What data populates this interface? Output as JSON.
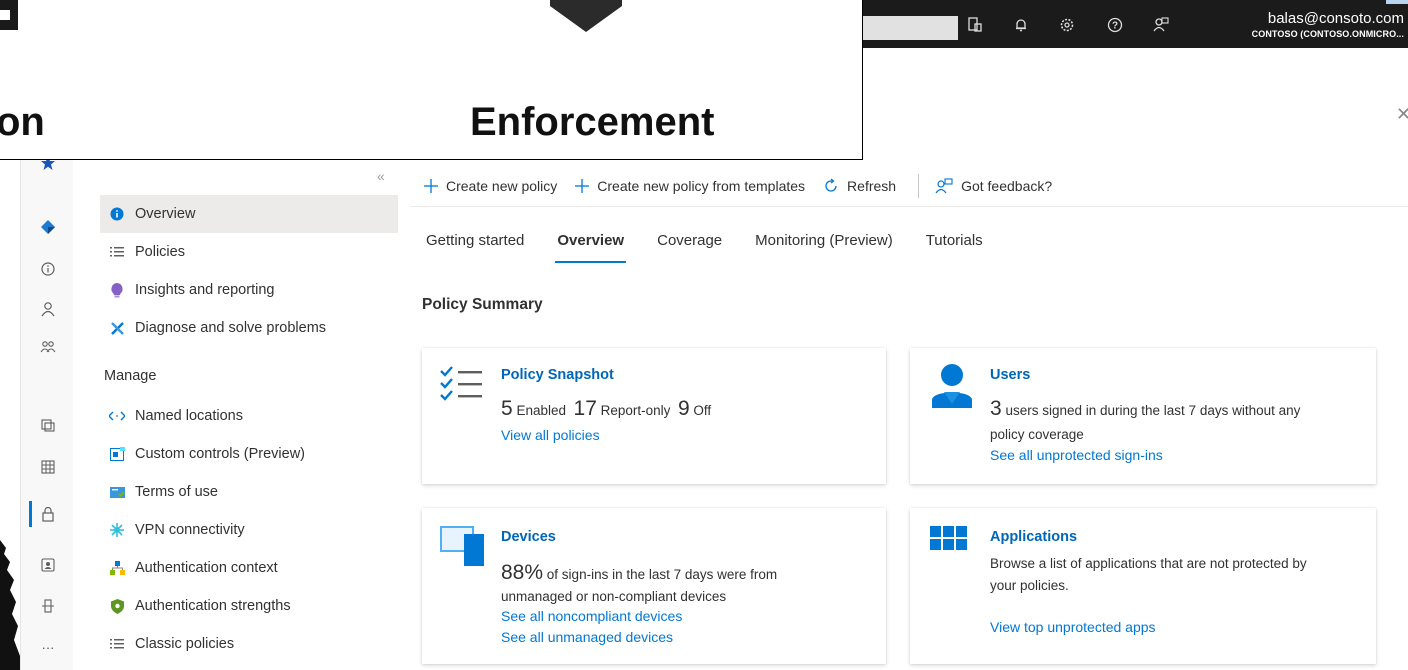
{
  "overlay": {
    "word_left": "on",
    "word_right": "Enforcement"
  },
  "topbar": {
    "account_email": "balas@consoto.com",
    "account_tenant": "CONTOSO (CONTOSO.ONMICRO..."
  },
  "sidebar": {
    "items": [
      {
        "label": "Overview",
        "icon": "info-icon"
      },
      {
        "label": "Policies",
        "icon": "list-icon"
      },
      {
        "label": "Insights and reporting",
        "icon": "lightbulb-icon"
      },
      {
        "label": "Diagnose and solve problems",
        "icon": "wrench-icon"
      }
    ],
    "manage_heading": "Manage",
    "manage_items": [
      {
        "label": "Named locations",
        "icon": "location-arrows-icon"
      },
      {
        "label": "Custom controls (Preview)",
        "icon": "custom-controls-icon"
      },
      {
        "label": "Terms of use",
        "icon": "terms-icon"
      },
      {
        "label": "VPN connectivity",
        "icon": "vpn-icon"
      },
      {
        "label": "Authentication context",
        "icon": "auth-context-icon"
      },
      {
        "label": "Authentication strengths",
        "icon": "shield-icon"
      },
      {
        "label": "Classic policies",
        "icon": "list-icon"
      }
    ]
  },
  "commands": {
    "create_policy": "Create new policy",
    "create_from_templates": "Create new policy from templates",
    "refresh": "Refresh",
    "feedback": "Got feedback?"
  },
  "tabs": [
    "Getting started",
    "Overview",
    "Coverage",
    "Monitoring (Preview)",
    "Tutorials"
  ],
  "active_tab": "Overview",
  "summary_heading": "Policy Summary",
  "cards": {
    "snapshot": {
      "title": "Policy Snapshot",
      "enabled_count": "5",
      "enabled_label": "Enabled",
      "report_count": "17",
      "report_label": "Report-only",
      "off_count": "9",
      "off_label": "Off",
      "link": "View all policies"
    },
    "users": {
      "title": "Users",
      "count": "3",
      "text_a": "users signed in during the last 7 days without any",
      "text_b": "policy coverage",
      "link": "See all unprotected sign-ins"
    },
    "devices": {
      "title": "Devices",
      "percent": "88%",
      "text_a": "of sign-ins in the last 7 days were from",
      "text_b": "unmanaged or non-compliant devices",
      "link1": "See all noncompliant devices",
      "link2": "See all unmanaged devices"
    },
    "applications": {
      "title": "Applications",
      "text_a": "Browse a list of applications that are not protected by",
      "text_b": "your policies.",
      "link": "View top unprotected apps"
    }
  },
  "colors": {
    "accent": "#0078d4",
    "link": "#0078d4",
    "title_blue": "#0067b8",
    "topbar": "#1b1b1b"
  }
}
